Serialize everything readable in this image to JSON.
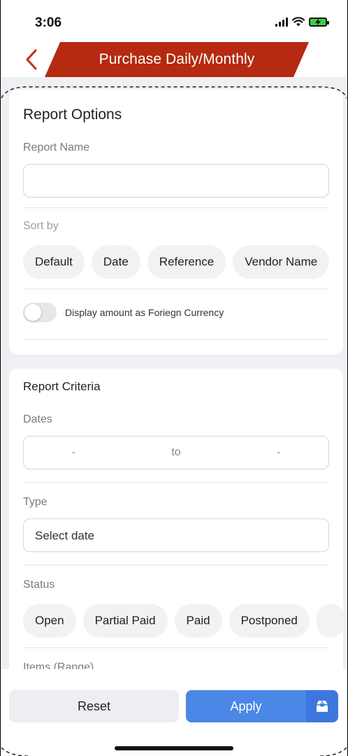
{
  "status_bar": {
    "time": "3:06",
    "icons": [
      "signal-icon",
      "wifi-icon",
      "battery-charging-icon"
    ]
  },
  "header": {
    "title": "Purchase Daily/Monthly",
    "back_icon": "chevron-left-icon",
    "accent_color": "#b52a10"
  },
  "report_options": {
    "title": "Report Options",
    "report_name": {
      "label": "Report Name",
      "value": "",
      "placeholder": ""
    },
    "sort_by": {
      "label": "Sort by",
      "options": [
        "Default",
        "Date",
        "Reference",
        "Vendor Name"
      ]
    },
    "foreign_currency_toggle": {
      "label": "Display amount as Foriegn Currency",
      "enabled": false
    }
  },
  "report_criteria": {
    "title": "Report Criteria",
    "dates": {
      "label": "Dates",
      "from": "-",
      "separator": "to",
      "to": "-"
    },
    "type": {
      "label": "Type",
      "placeholder": "Select date"
    },
    "status": {
      "label": "Status",
      "options": [
        "Open",
        "Partial Paid",
        "Paid",
        "Postponed"
      ]
    },
    "items_range": {
      "label": "Items (Range)"
    }
  },
  "actions": {
    "reset_label": "Reset",
    "apply_label": "Apply",
    "save_icon": "save-report-icon",
    "apply_color": "#4a87e6"
  }
}
